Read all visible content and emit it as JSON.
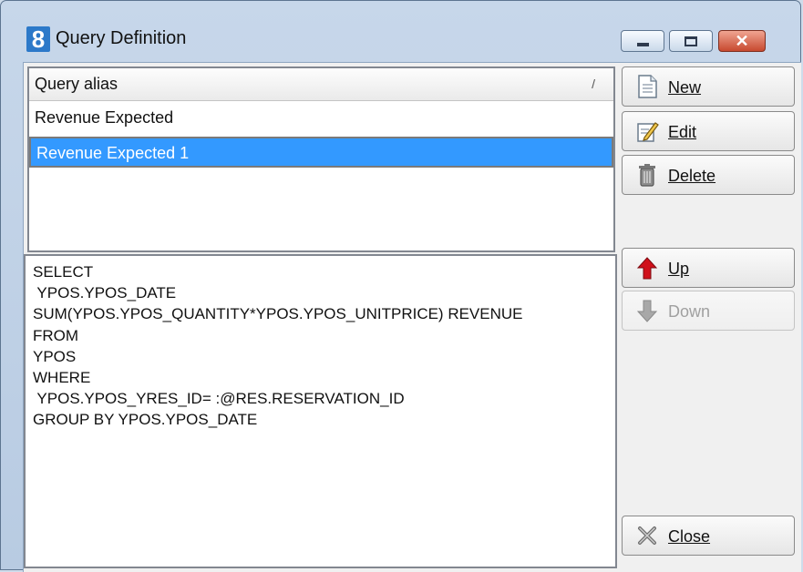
{
  "window": {
    "app_icon_text": "8",
    "title": "Query Definition"
  },
  "list": {
    "header": "Query alias",
    "sort_indicator": "/",
    "rows": [
      "Revenue Expected",
      "Revenue Expected 1"
    ],
    "selected_index": 1
  },
  "sql": {
    "text": "SELECT\n YPOS.YPOS_DATE\nSUM(YPOS.YPOS_QUANTITY*YPOS.YPOS_UNITPRICE) REVENUE\nFROM\nYPOS\nWHERE\n YPOS.YPOS_YRES_ID= :@RES.RESERVATION_ID\nGROUP BY YPOS.YPOS_DATE"
  },
  "buttons": {
    "new": "New",
    "edit": "Edit",
    "delete": "Delete",
    "up": "Up",
    "down": "Down",
    "close": "Close"
  },
  "colors": {
    "selection": "#3399ff",
    "up_arrow": "#d0101a",
    "down_arrow_disabled": "#a8a8a8"
  },
  "icons": [
    "document-icon",
    "edit-pencil-icon",
    "trash-icon",
    "arrow-up-icon",
    "arrow-down-icon",
    "close-tools-icon"
  ]
}
